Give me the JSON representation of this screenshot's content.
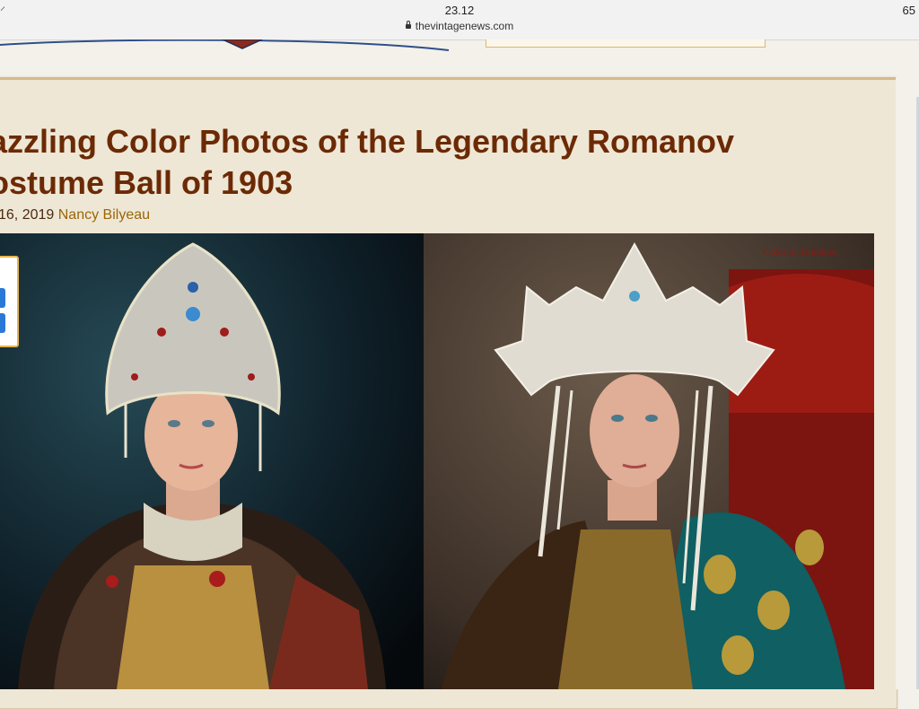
{
  "status_bar": {
    "time": "23.12",
    "url": "thevintagenews.com",
    "battery": "65",
    "left_glyph": "⸍"
  },
  "article": {
    "title_line1": "azzling Color Photos of the Legendary Romanov",
    "title_line2": "ostume Ball of 1903",
    "date": "16, 2019",
    "author": "Nancy Bilyeau",
    "photo_credit": "Color by Klimbim"
  },
  "colors": {
    "title": "#6b2a05",
    "author_link": "#9a6608",
    "card_bg": "#efe7d5",
    "share_blue": "#2a79d8"
  }
}
